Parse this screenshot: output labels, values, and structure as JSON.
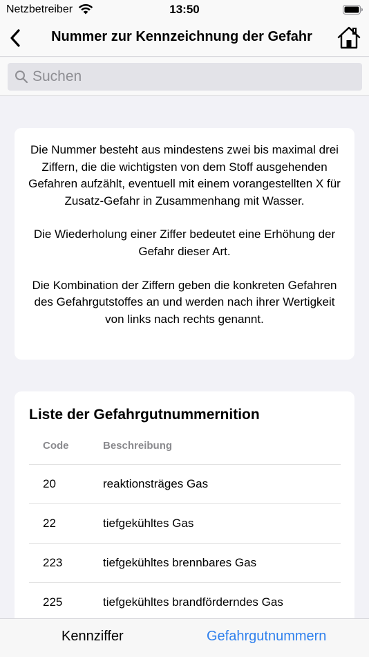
{
  "status_bar": {
    "carrier": "Netzbetreiber",
    "time": "13:50"
  },
  "nav": {
    "title": "Nummer zur Kennzeichnung der Gefahr",
    "back_icon": "chevron-left-icon",
    "home_icon": "home-icon"
  },
  "search": {
    "placeholder": "Suchen",
    "value": ""
  },
  "info": {
    "paragraphs": [
      "Die Nummer besteht aus mindestens zwei bis maximal drei Ziffern, die die wichtigsten von dem Stoff ausgehenden Gefahren aufzählt, eventuell mit einem vorangestellten X für Zusatz-Gefahr in Zusammenhang mit Wasser.",
      "Die Wiederholung einer Ziffer bedeutet eine Erhöhung der Gefahr dieser Art.",
      "Die Kombination der Ziffern geben die konkreten Gefahren des Gefahrgutstoffes an und werden nach ihrer Wertigkeit von links nach rechts genannt."
    ]
  },
  "list": {
    "title": "Liste der Gefahrgutnummernition",
    "columns": {
      "code": "Code",
      "description": "Beschreibung"
    },
    "rows": [
      {
        "code": "20",
        "description": "reaktionsträges Gas"
      },
      {
        "code": "22",
        "description": "tiefgekühltes Gas"
      },
      {
        "code": "223",
        "description": "tiefgekühltes brennbares Gas"
      },
      {
        "code": "225",
        "description": "tiefgekühltes brandförderndes Gas"
      }
    ]
  },
  "tabs": [
    {
      "label": "Kennziffer",
      "active": false
    },
    {
      "label": "Gefahrgutnummern",
      "active": true
    }
  ],
  "colors": {
    "accent": "#2f80ed",
    "background": "#f2f2f7",
    "card": "#ffffff"
  }
}
